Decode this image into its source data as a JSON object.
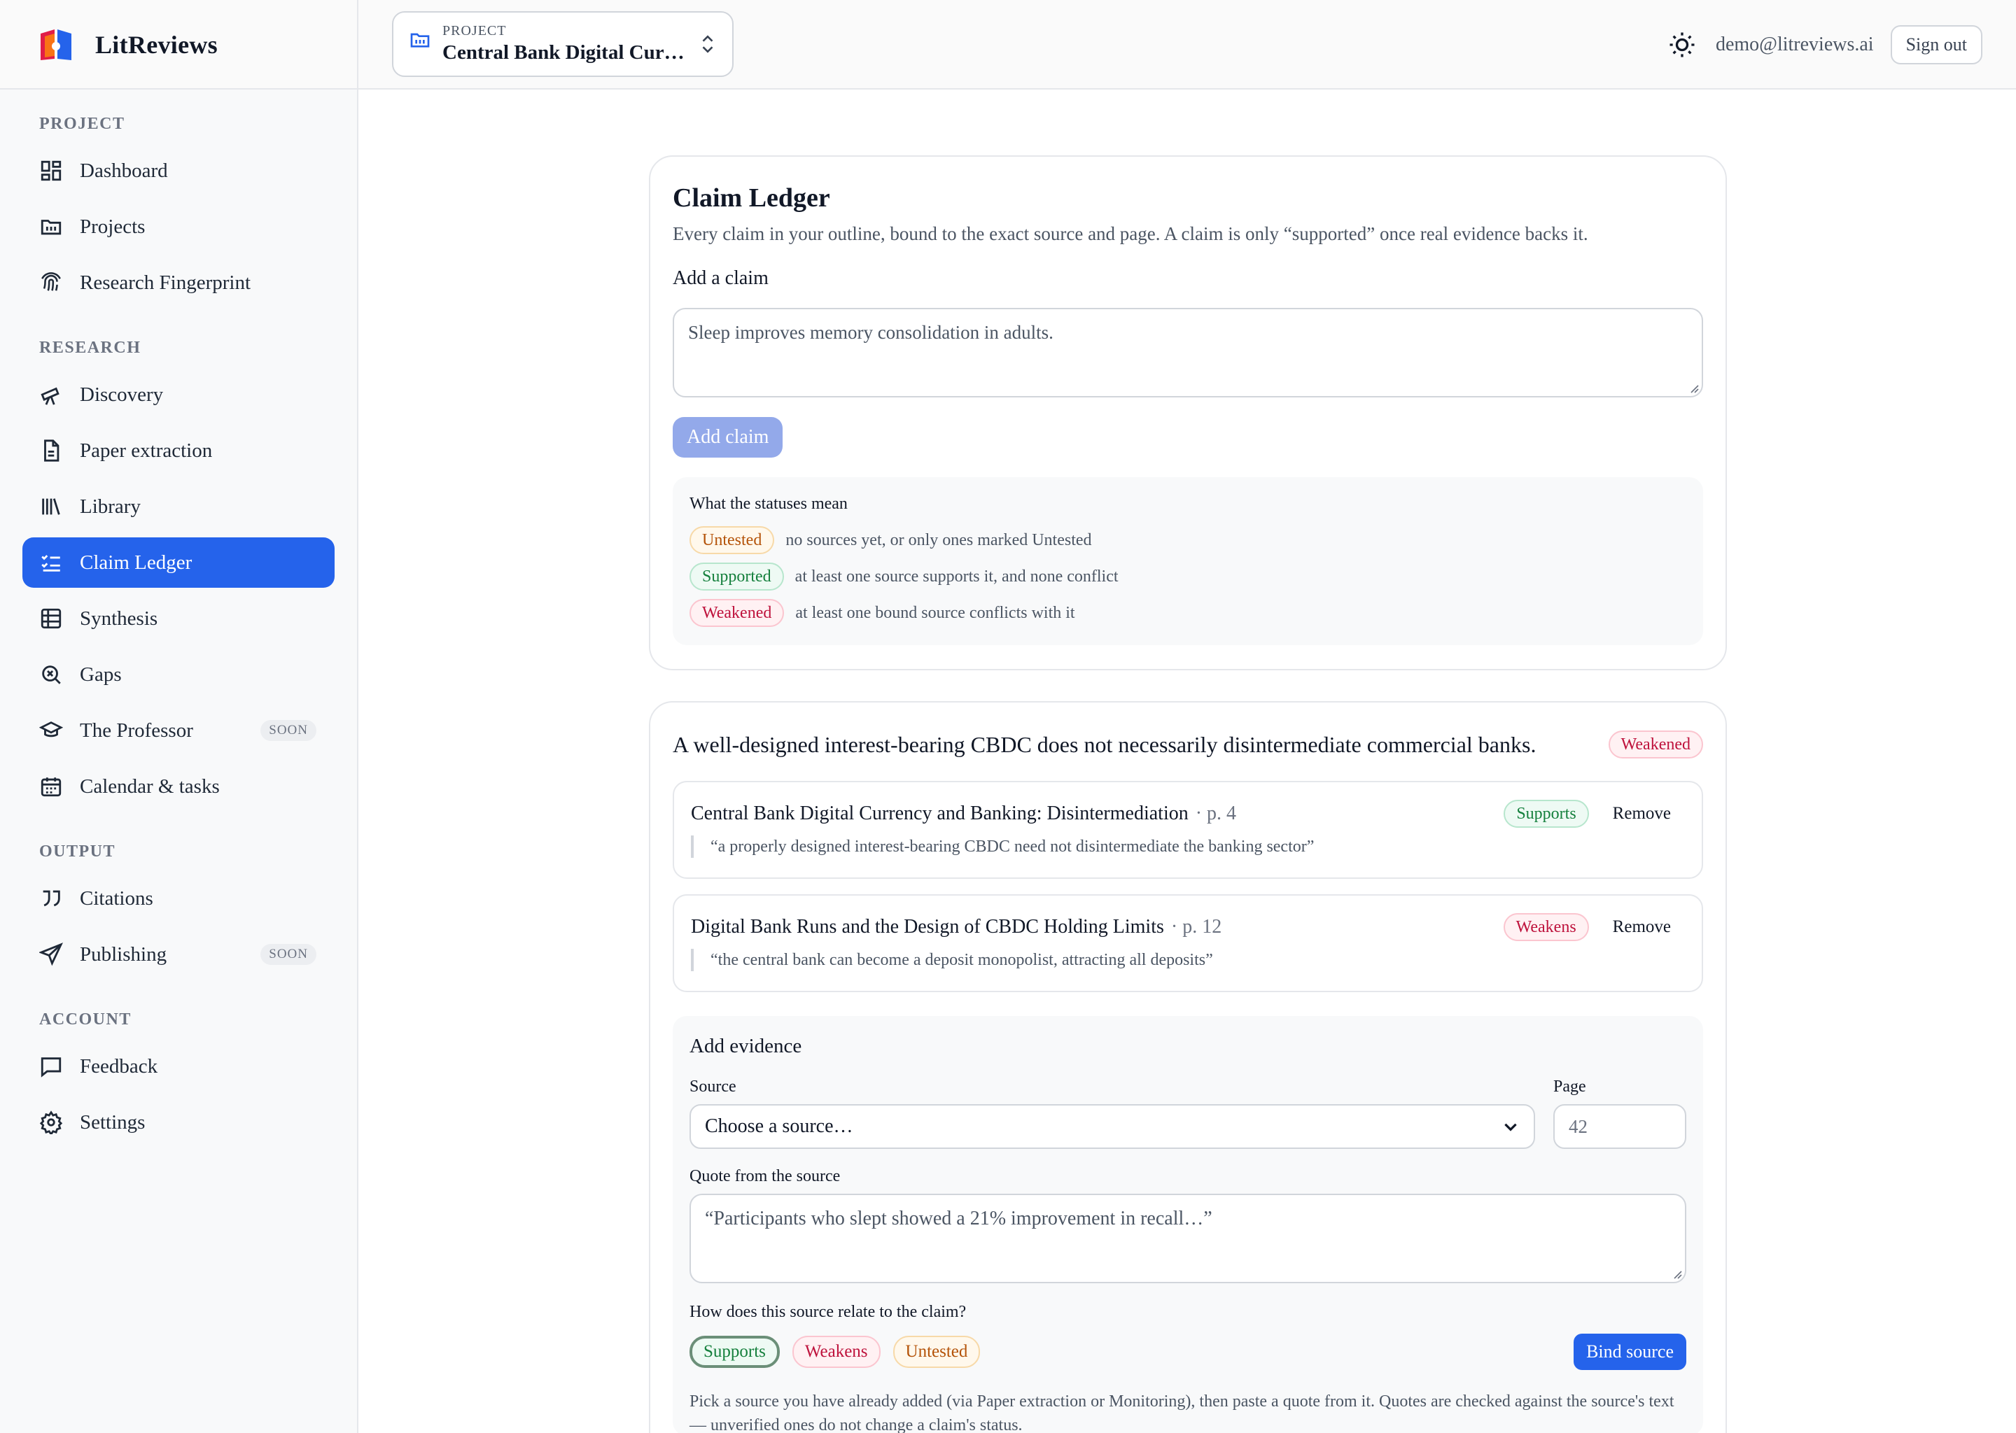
{
  "app": {
    "name": "LitReviews",
    "logo_icon": "book-logo-icon"
  },
  "project_switcher": {
    "label": "PROJECT",
    "name": "Central Bank Digital Curr…"
  },
  "user": {
    "email": "demo@litreviews.ai",
    "sign_out": "Sign out"
  },
  "sidebar": {
    "sections": [
      {
        "title": "PROJECT",
        "items": [
          {
            "label": "Dashboard",
            "icon": "dashboard-icon"
          },
          {
            "label": "Projects",
            "icon": "folder-icon"
          },
          {
            "label": "Research Fingerprint",
            "icon": "fingerprint-icon"
          }
        ]
      },
      {
        "title": "RESEARCH",
        "items": [
          {
            "label": "Discovery",
            "icon": "telescope-icon"
          },
          {
            "label": "Paper extraction",
            "icon": "document-icon"
          },
          {
            "label": "Library",
            "icon": "library-icon"
          },
          {
            "label": "Claim Ledger",
            "icon": "checklist-icon",
            "active": true
          },
          {
            "label": "Synthesis",
            "icon": "table-icon"
          },
          {
            "label": "Gaps",
            "icon": "search-x-icon"
          },
          {
            "label": "The Professor",
            "icon": "graduation-cap-icon",
            "badge": "SOON"
          },
          {
            "label": "Calendar & tasks",
            "icon": "calendar-icon"
          }
        ]
      },
      {
        "title": "OUTPUT",
        "items": [
          {
            "label": "Citations",
            "icon": "quote-icon"
          },
          {
            "label": "Publishing",
            "icon": "send-icon",
            "badge": "SOON"
          }
        ]
      },
      {
        "title": "ACCOUNT",
        "items": [
          {
            "label": "Feedback",
            "icon": "message-icon"
          },
          {
            "label": "Settings",
            "icon": "gear-icon"
          }
        ]
      }
    ]
  },
  "ledger": {
    "title": "Claim Ledger",
    "subtitle": "Every claim in your outline, bound to the exact source and page. A claim is only “supported” once real evidence backs it.",
    "add_claim_label": "Add a claim",
    "claim_placeholder": "Sleep improves memory consolidation in adults.",
    "add_claim_button": "Add claim",
    "legend_title": "What the statuses mean",
    "legend": [
      {
        "status": "Untested",
        "desc": "no sources yet, or only ones marked Untested"
      },
      {
        "status": "Supported",
        "desc": "at least one source supports it, and none conflict"
      },
      {
        "status": "Weakened",
        "desc": "at least one bound source conflicts with it"
      }
    ]
  },
  "claim": {
    "text": "A well-designed interest-bearing CBDC does not necessarily disintermediate commercial banks.",
    "status": "Weakened",
    "evidence": [
      {
        "title": "Central Bank Digital Currency and Banking: Disintermediation",
        "page": "· p. 4",
        "relation": "Supports",
        "remove": "Remove",
        "quote": "“a properly designed interest-bearing CBDC need not disintermediate the banking sector”"
      },
      {
        "title": "Digital Bank Runs and the Design of CBDC Holding Limits",
        "page": "· p. 12",
        "relation": "Weakens",
        "remove": "Remove",
        "quote": "“the central bank can become a deposit monopolist, attracting all deposits”"
      }
    ],
    "add_evidence": {
      "title": "Add evidence",
      "source_label": "Source",
      "source_value": "Choose a source…",
      "page_label": "Page",
      "page_placeholder": "42",
      "quote_label": "Quote from the source",
      "quote_placeholder": "“Participants who slept showed a 21% improvement in recall…”",
      "relate_label": "How does this source relate to the claim?",
      "options": [
        "Supports",
        "Weakens",
        "Untested"
      ],
      "selected_option": "Supports",
      "bind_button": "Bind source",
      "help": "Pick a source you have already added (via Paper extraction or Monitoring), then paste a quote from it. Quotes are checked against the source's text — unverified ones do not change a claim's status."
    }
  },
  "colors": {
    "accent": "#2563eb",
    "supported": "#15803d",
    "weakened": "#be123c",
    "untested": "#b45309"
  }
}
